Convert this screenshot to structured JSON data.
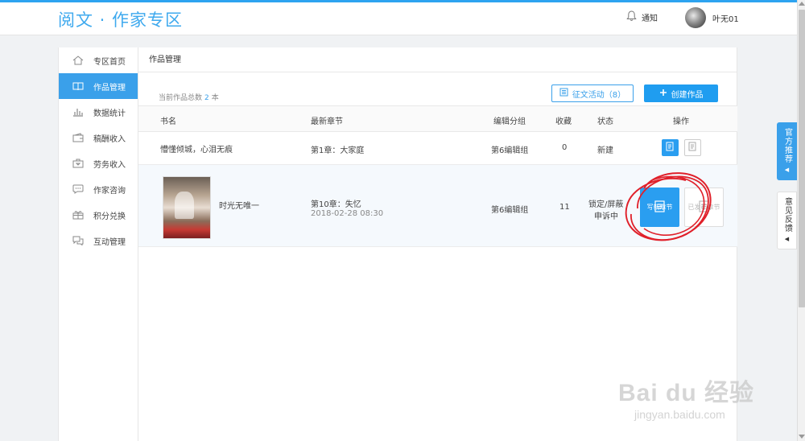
{
  "header": {
    "logo": "阅文 · 作家专区",
    "notification_label": "通知",
    "username": "叶无01"
  },
  "sidebar": {
    "items": [
      {
        "label": "专区首页",
        "icon": "home-icon",
        "active": false
      },
      {
        "label": "作品管理",
        "icon": "book-icon",
        "active": true
      },
      {
        "label": "数据统计",
        "icon": "bar-chart-icon",
        "active": false
      },
      {
        "label": "稿酬收入",
        "icon": "wallet-icon",
        "active": false
      },
      {
        "label": "劳务收入",
        "icon": "briefcase-icon",
        "active": false
      },
      {
        "label": "作家咨询",
        "icon": "chat-bubble-icon",
        "active": false
      },
      {
        "label": "积分兑换",
        "icon": "gift-icon",
        "active": false
      },
      {
        "label": "互动管理",
        "icon": "comments-icon",
        "active": false
      }
    ]
  },
  "main": {
    "title": "作品管理",
    "count_prefix": "当前作品总数",
    "count_value": "2",
    "count_suffix": "本",
    "contest_button": "征文活动（8）",
    "create_button": "创建作品",
    "columns": {
      "book": "书名",
      "latest": "最新章节",
      "group": "编辑分组",
      "favorites": "收藏",
      "status": "状态",
      "actions": "操作"
    },
    "rows": [
      {
        "title": "懵懂倾城，心泪无痕",
        "latest_chapter": "第1章：大家庭",
        "latest_time": "",
        "group": "第6编辑组",
        "favorites": "0",
        "status": "新建"
      },
      {
        "title": "时光无唯一",
        "latest_chapter": "第10章：失忆",
        "latest_time": "2018-02-28 08:30",
        "group": "第6编辑组",
        "favorites": "11",
        "status_line1": "锁定/屏蔽",
        "status_line2": "申诉中",
        "action_write": "写新章节",
        "action_manage": "已发布章节"
      }
    ]
  },
  "float_tabs": {
    "recommend": "官方推荐",
    "feedback": "意见反馈"
  },
  "watermark": {
    "main": "Bai du 经验",
    "sub": "jingyan.baidu.com"
  },
  "colors": {
    "accent": "#3aa0ea",
    "button_blue": "#1f9df0",
    "annotation_red": "#e0202a"
  }
}
